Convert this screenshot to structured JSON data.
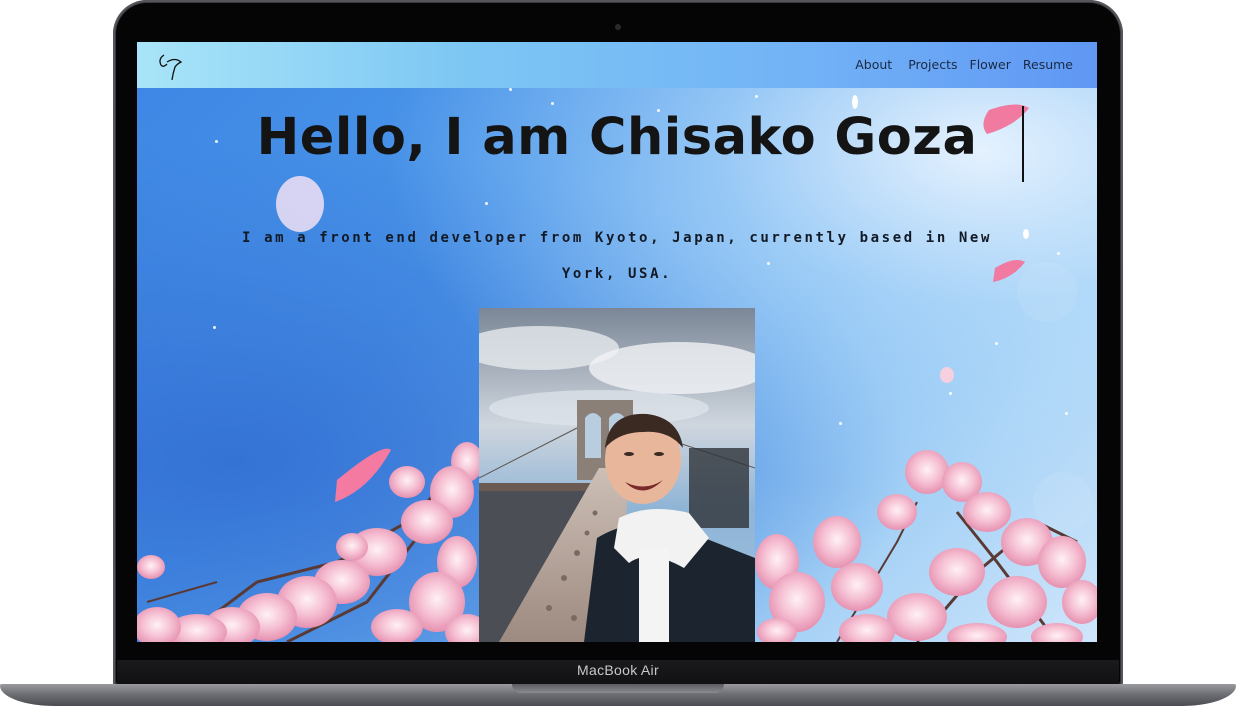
{
  "device": {
    "model_label": "MacBook Air"
  },
  "site": {
    "logo_icon": "cg-monogram-icon",
    "nav": [
      {
        "label": "About"
      },
      {
        "label": "Projects"
      },
      {
        "label": "Flower"
      },
      {
        "label": "Resume"
      }
    ],
    "hero": {
      "title": "Hello, I am Chisako Goza",
      "subtitle": "I am a front end developer from Kyoto, Japan, currently based in New York, USA."
    },
    "photo": {
      "icon": "portrait-photo"
    },
    "colors": {
      "background_blue": "#4b97ea",
      "nav_gradient_start": "#a9e5f8",
      "nav_gradient_end": "#5f97f4",
      "blossom_pink": "#f4b8cb",
      "title_text": "#141414"
    }
  }
}
